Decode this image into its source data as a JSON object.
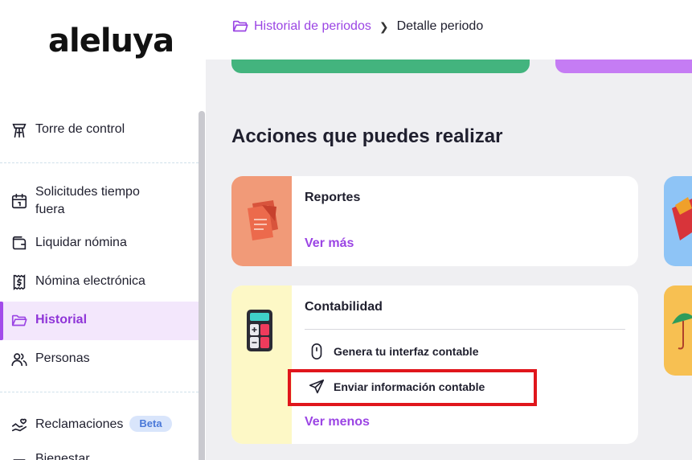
{
  "sidebar": {
    "logo": "aleluya",
    "items": [
      {
        "label": "Torre de control",
        "icon": "control-tower-icon"
      },
      {
        "label": "Solicitudes tiempo fuera",
        "icon": "calendar-icon"
      },
      {
        "label": "Liquidar nómina",
        "icon": "wallet-icon"
      },
      {
        "label": "Nómina electrónica",
        "icon": "dollar-receipt-icon"
      },
      {
        "label": "Historial",
        "icon": "folder-icon",
        "active": true
      },
      {
        "label": "Personas",
        "icon": "people-icon"
      },
      {
        "label": "Reclamaciones",
        "icon": "hand-heart-icon",
        "badge": "Beta"
      },
      {
        "label": "Bienestar",
        "icon": "wellness-icon"
      }
    ]
  },
  "breadcrumb": {
    "parent": "Historial de periodos",
    "current": "Detalle periodo"
  },
  "main": {
    "section_title": "Acciones que puedes realizar",
    "cards": [
      {
        "title": "Reportes",
        "link": "Ver más",
        "image_color": "#f19a78"
      },
      {
        "title": "Contabilidad",
        "actions": [
          {
            "label": "Genera tu interfaz contable",
            "icon": "mouse-icon"
          },
          {
            "label": "Enviar información contable",
            "icon": "send-icon"
          }
        ],
        "link": "Ver menos",
        "image_color": "#fdf8c6"
      }
    ]
  },
  "colors": {
    "accent": "#9b45e4",
    "active_bg": "#f3e7fc",
    "highlight": "#e0161c",
    "green": "#43b47e"
  }
}
